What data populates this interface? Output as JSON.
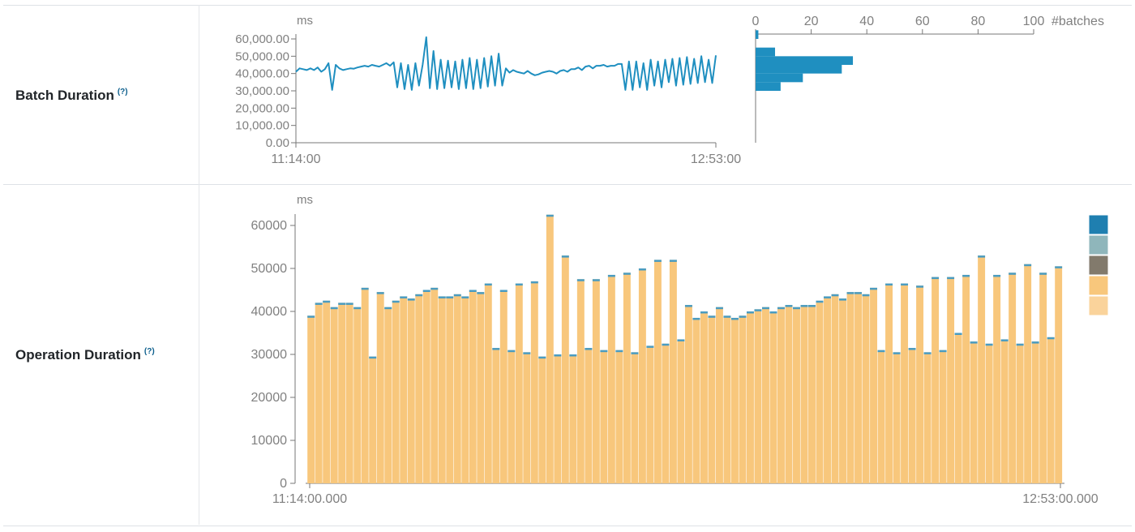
{
  "rows": {
    "batch_label": "Batch Duration",
    "operation_label": "Operation Duration",
    "help_marker": "(?)"
  },
  "colors": {
    "line": "#1f8fc0",
    "hist": "#1f8fc0",
    "bar_main": "#f8c77c",
    "bar_top": "#4a9cc1",
    "legend": [
      "#1f7fb0",
      "#8fb6bb",
      "#827a6c",
      "#f8c77c",
      "#fad39b"
    ]
  },
  "chart_data": [
    {
      "type": "line",
      "ylabel": "ms",
      "yticks": [
        "0.00",
        "10,000.00",
        "20,000.00",
        "30,000.00",
        "40,000.00",
        "50,000.00",
        "60,000.00"
      ],
      "ylim": [
        0,
        60000
      ],
      "x": [
        "11:14:00",
        "12:53:00"
      ],
      "xticks": [
        "11:14:00",
        "12:53:00"
      ],
      "values": [
        41000,
        43000,
        42500,
        42000,
        43000,
        42000,
        43500,
        41000,
        42500,
        46000,
        30500,
        45000,
        43000,
        42000,
        42500,
        43000,
        42800,
        43500,
        44000,
        44500,
        44000,
        45000,
        44500,
        44000,
        45000,
        46000,
        44500,
        46500,
        32000,
        46000,
        31000,
        45000,
        30500,
        46000,
        33000,
        45000,
        61000,
        31500,
        53000,
        31000,
        48000,
        31500,
        47500,
        32000,
        47000,
        31000,
        48000,
        31500,
        49000,
        31000,
        48000,
        31500,
        49000,
        32500,
        50000,
        33000,
        51500,
        33000,
        43000,
        40500,
        42000,
        41000,
        40500,
        40000,
        41500,
        40000,
        39000,
        39500,
        40500,
        41000,
        41500,
        41000,
        40000,
        41500,
        42000,
        41000,
        42500,
        42500,
        43500,
        42000,
        44000,
        44500,
        43000,
        44500,
        44500,
        45000,
        44000,
        44500,
        44500,
        45500,
        45500,
        30500,
        47000,
        30500,
        47000,
        32000,
        46000,
        30500,
        48000,
        33000,
        47000,
        32000,
        48000,
        35000,
        48500,
        33000,
        49000,
        33500,
        49500,
        34000,
        48500,
        34500,
        50000,
        35000,
        48000,
        34500,
        50500
      ]
    },
    {
      "type": "bar",
      "xlabel": "#batches",
      "xticks": [
        "0",
        "20",
        "40",
        "60",
        "80",
        "100"
      ],
      "xlim": [
        0,
        100
      ],
      "bins": [
        {
          "from": 60000,
          "to": 65000,
          "count": 1
        },
        {
          "from": 55000,
          "to": 60000,
          "count": 0
        },
        {
          "from": 50000,
          "to": 55000,
          "count": 7
        },
        {
          "from": 45000,
          "to": 50000,
          "count": 35
        },
        {
          "from": 40000,
          "to": 45000,
          "count": 31
        },
        {
          "from": 35000,
          "to": 40000,
          "count": 17
        },
        {
          "from": 30000,
          "to": 35000,
          "count": 9
        },
        {
          "from": 25000,
          "to": 30000,
          "count": 0
        }
      ]
    },
    {
      "type": "bar",
      "ylabel": "ms",
      "yticks": [
        "0",
        "10000",
        "20000",
        "30000",
        "40000",
        "50000",
        "60000"
      ],
      "ylim": [
        0,
        62500
      ],
      "xticks": [
        "11:14:00.000",
        "12:53:00.000"
      ],
      "values": [
        39000,
        42000,
        42500,
        41000,
        42000,
        42000,
        41000,
        45500,
        29500,
        44500,
        41000,
        42500,
        43500,
        43000,
        44000,
        45000,
        45500,
        43500,
        43500,
        44000,
        43500,
        45000,
        44500,
        46500,
        31500,
        45000,
        31000,
        46500,
        30500,
        47000,
        29500,
        62500,
        30000,
        53000,
        30000,
        47500,
        31500,
        47500,
        31000,
        48500,
        31000,
        49000,
        30500,
        50000,
        32000,
        52000,
        32500,
        52000,
        33500,
        41500,
        38500,
        40000,
        39000,
        41000,
        39000,
        38500,
        39000,
        40000,
        40500,
        41000,
        40000,
        41000,
        41500,
        41000,
        41500,
        41500,
        42500,
        43500,
        44000,
        43000,
        44500,
        44500,
        44000,
        45500,
        31000,
        46500,
        30500,
        46500,
        31500,
        46000,
        30500,
        48000,
        31000,
        48000,
        35000,
        48500,
        33000,
        53000,
        32500,
        48500,
        33500,
        49000,
        32500,
        51000,
        33000,
        49000,
        34000,
        50500
      ]
    }
  ]
}
